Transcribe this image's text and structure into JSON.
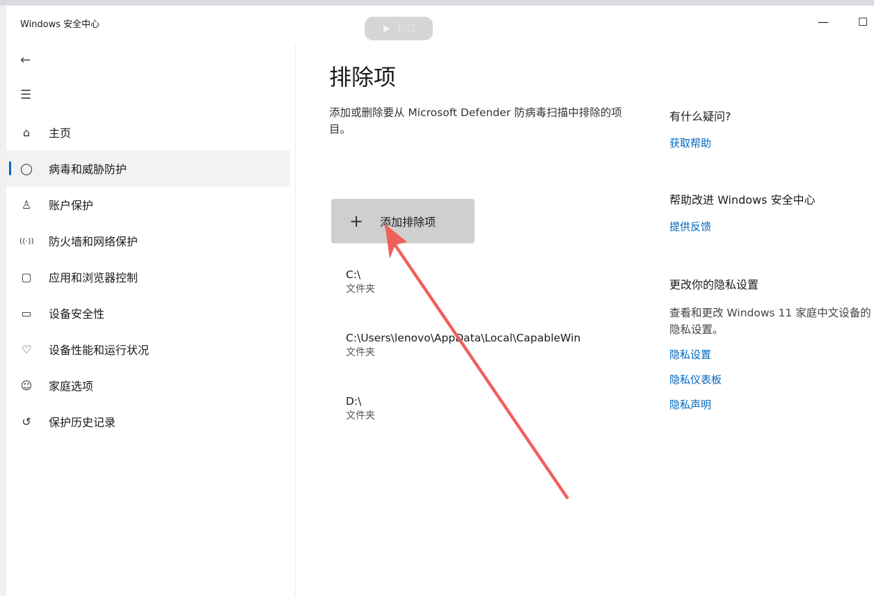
{
  "window": {
    "title": "Windows 安全中心",
    "minimize_glyph": "—",
    "maximize_glyph": "☐",
    "float_toolbar": {
      "play_glyph": "▶",
      "expand_glyph": "⛶"
    }
  },
  "sidebar": {
    "back_glyph": "←",
    "menu_glyph": "☰",
    "items": [
      {
        "label": "主页",
        "icon": "home-icon",
        "glyph": "⌂",
        "active": false
      },
      {
        "label": "病毒和威胁防护",
        "icon": "shield-icon",
        "glyph": "◯",
        "active": true
      },
      {
        "label": "账户保护",
        "icon": "person-icon",
        "glyph": "♙",
        "active": false
      },
      {
        "label": "防火墙和网络保护",
        "icon": "wifi-antenna-icon",
        "glyph": "((·))",
        "active": false
      },
      {
        "label": "应用和浏览器控制",
        "icon": "app-window-icon",
        "glyph": "▢",
        "active": false
      },
      {
        "label": "设备安全性",
        "icon": "laptop-icon",
        "glyph": "▭",
        "active": false
      },
      {
        "label": "设备性能和运行状况",
        "icon": "heart-pulse-icon",
        "glyph": "♡",
        "active": false
      },
      {
        "label": "家庭选项",
        "icon": "family-icon",
        "glyph": "☺",
        "active": false
      },
      {
        "label": "保护历史记录",
        "icon": "history-icon",
        "glyph": "↺",
        "active": false
      }
    ]
  },
  "main": {
    "title": "排除项",
    "description": "添加或删除要从 Microsoft Defender 防病毒扫描中排除的项目。",
    "add_button": {
      "plus": "+",
      "label": "添加排除项"
    },
    "exclusions": [
      {
        "path": "C:\\",
        "type": "文件夹"
      },
      {
        "path": "C:\\Users\\lenovo\\AppData\\Local\\CapableWin",
        "type": "文件夹"
      },
      {
        "path": "D:\\",
        "type": "文件夹"
      }
    ]
  },
  "side_panel": {
    "help": {
      "heading": "有什么疑问?",
      "link": "获取帮助"
    },
    "improve": {
      "heading": "帮助改进 Windows 安全中心",
      "link": "提供反馈"
    },
    "privacy": {
      "heading": "更改你的隐私设置",
      "text": "查看和更改 Windows 11 家庭中文设备的隐私设置。",
      "links": [
        "隐私设置",
        "隐私仪表板",
        "隐私声明"
      ]
    }
  },
  "colors": {
    "accent": "#0067c0",
    "active_nav_bg": "#f2f2f2",
    "button_bg": "#cfcfcf",
    "annotation_arrow": "#f0605a"
  }
}
